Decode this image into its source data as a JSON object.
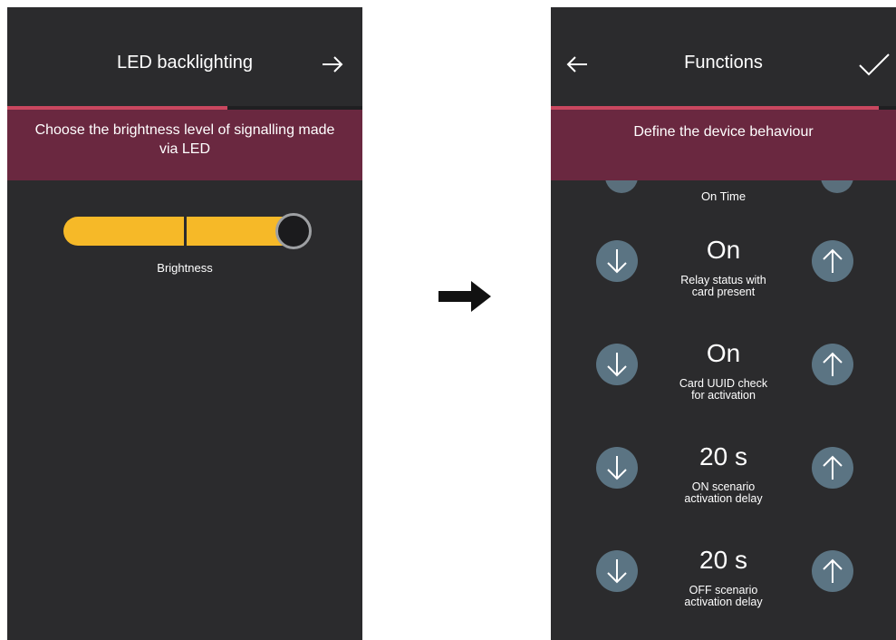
{
  "left_screen": {
    "title": "LED backlighting",
    "forward_icon": "arrow-right-icon",
    "progress_fraction": 0.62,
    "banner": "Choose the brightness level of signalling made via LED",
    "slider": {
      "label": "Brightness",
      "value_fraction": 1.0,
      "steps": 2
    }
  },
  "flow_arrow_icon": "arrow-right-icon",
  "right_screen": {
    "title": "Functions",
    "back_icon": "arrow-left-icon",
    "confirm_icon": "check-icon",
    "progress_fraction": 0.95,
    "banner": "Define the device behaviour",
    "partial_item_label": "On Time",
    "items": [
      {
        "value": "On",
        "label_line1": "Relay status with",
        "label_line2": "card present"
      },
      {
        "value": "On",
        "label_line1": "Card UUID check",
        "label_line2": "for activation"
      },
      {
        "value": "20 s",
        "label_line1": "ON scenario",
        "label_line2": "activation delay"
      },
      {
        "value": "20 s",
        "label_line1": "OFF scenario",
        "label_line2": "activation delay"
      }
    ],
    "decrement_icon": "arrow-down-icon",
    "increment_icon": "arrow-up-icon"
  }
}
